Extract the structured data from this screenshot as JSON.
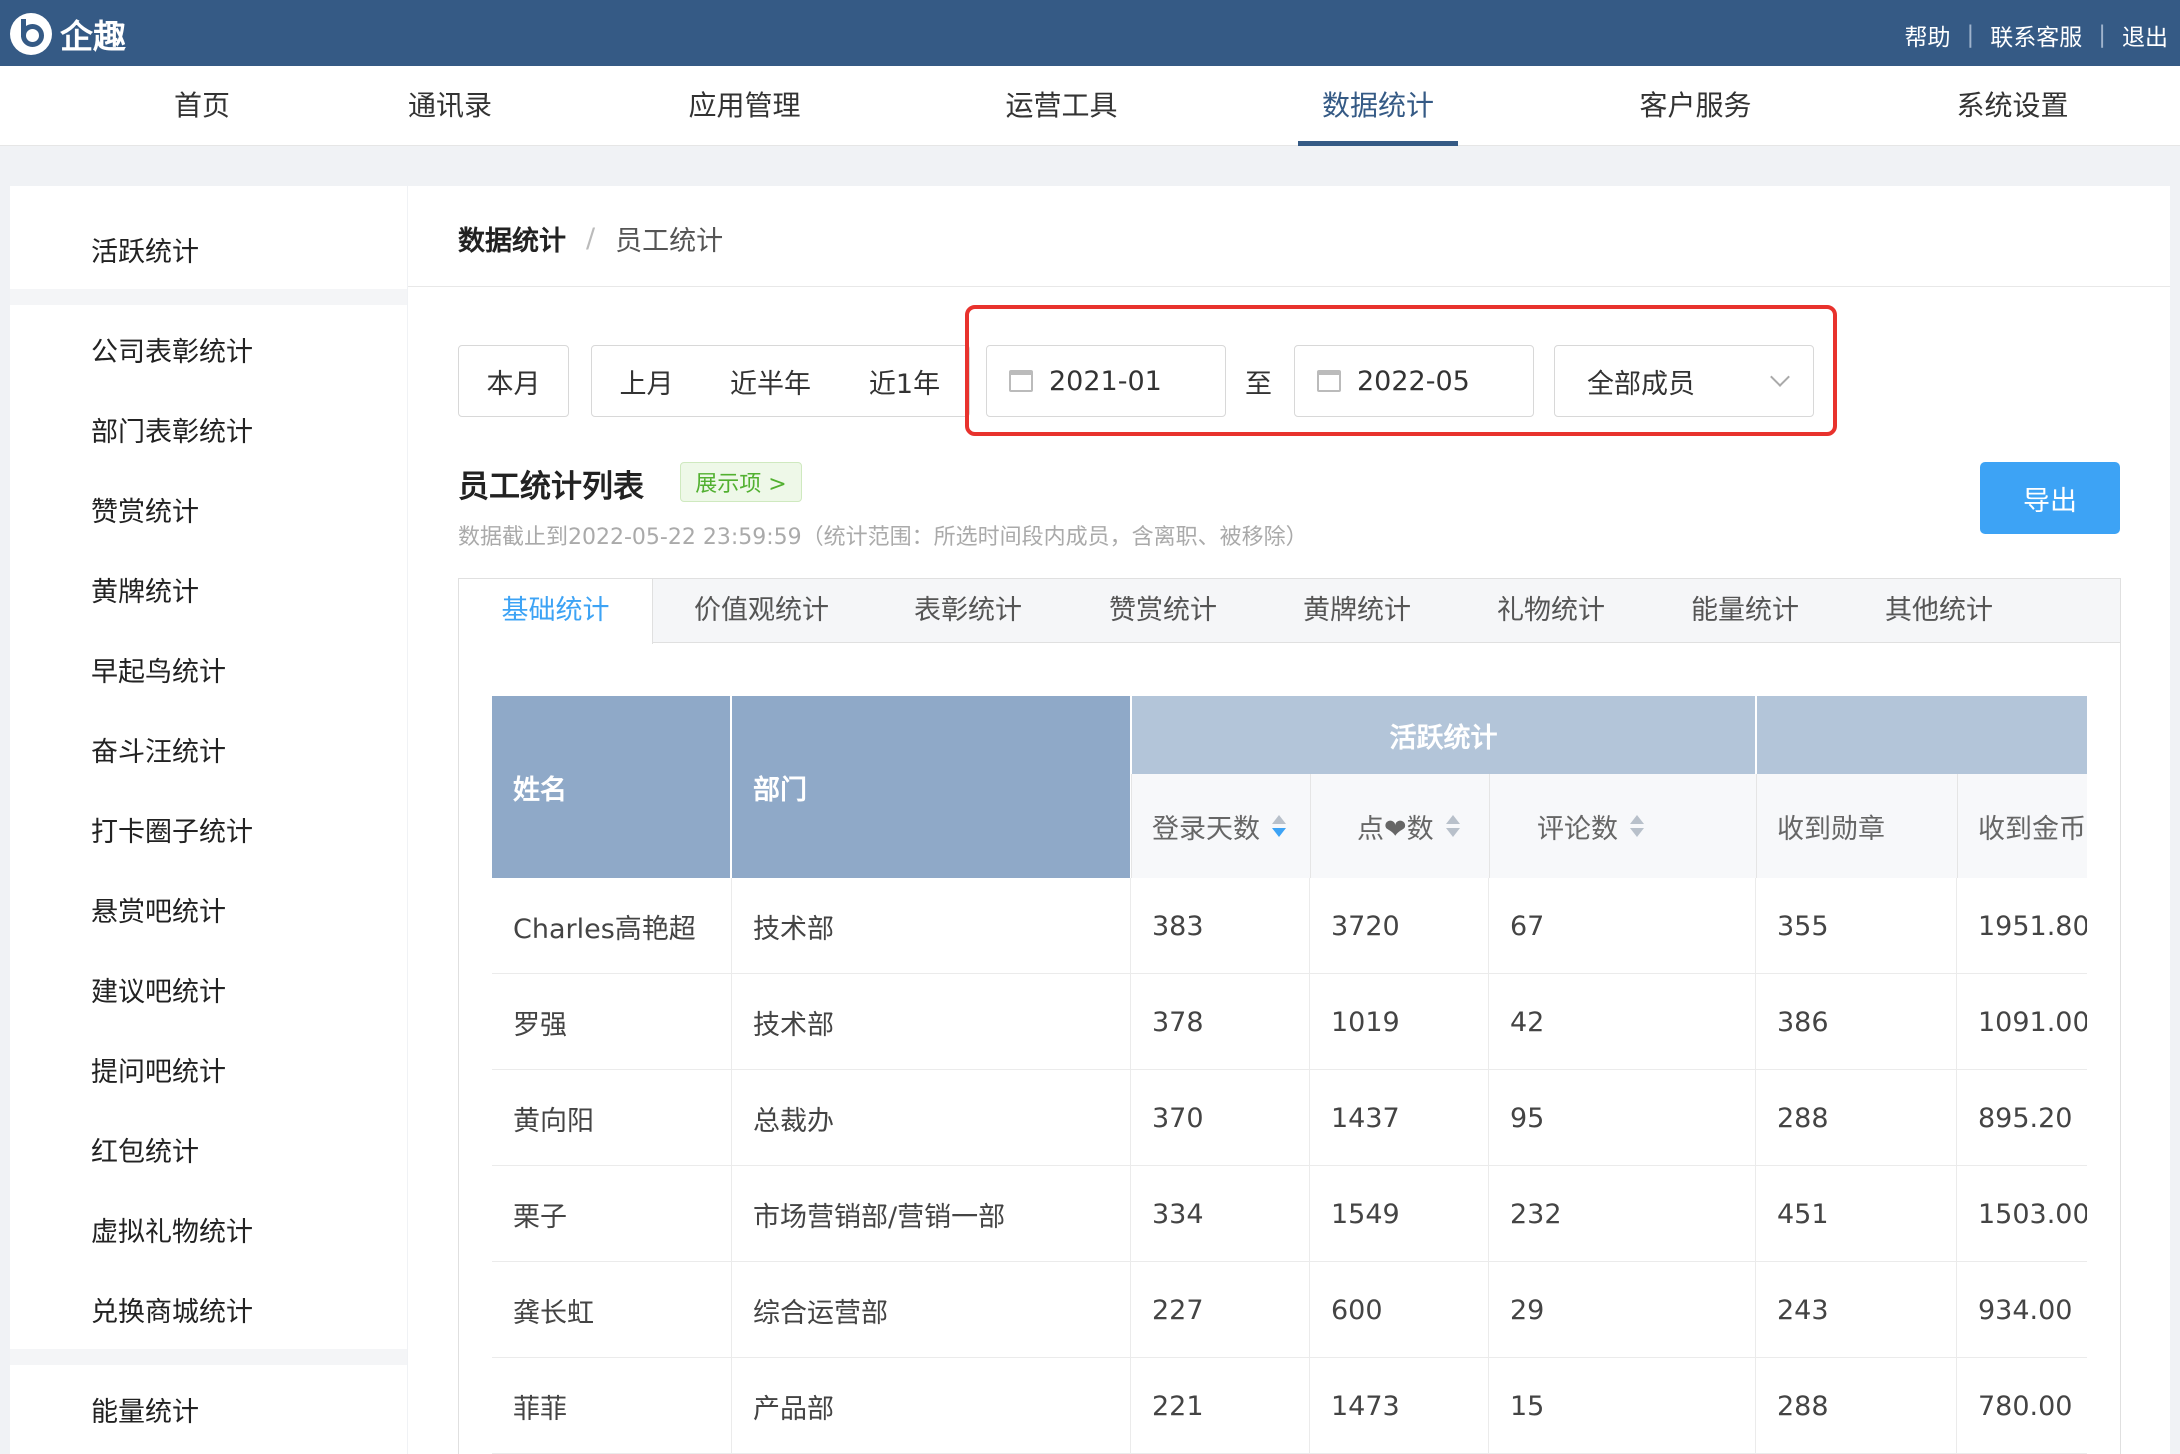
{
  "app": {
    "name": "企趣",
    "links": [
      "帮助",
      "联系客服",
      "退出"
    ]
  },
  "nav": {
    "items": [
      "首页",
      "通讯录",
      "应用管理",
      "运营工具",
      "数据统计",
      "客户服务",
      "系统设置"
    ],
    "active": "数据统计"
  },
  "sidebar": {
    "items": [
      "活跃统计",
      "公司表彰统计",
      "部门表彰统计",
      "赞赏统计",
      "黄牌统计",
      "早起鸟统计",
      "奋斗汪统计",
      "打卡圈子统计",
      "悬赏吧统计",
      "建议吧统计",
      "提问吧统计",
      "红包统计",
      "虚拟礼物统计",
      "兑换商城统计",
      "能量统计"
    ]
  },
  "breadcrumb": {
    "parent": "数据统计",
    "sep": "/",
    "current": "员工统计"
  },
  "filters": {
    "quick": [
      "本月",
      "上月",
      "近半年",
      "近1年"
    ],
    "start_date": "2021-01",
    "to_label": "至",
    "end_date": "2022-05",
    "member_select": "全部成员"
  },
  "list": {
    "title": "员工统计列表",
    "show_items": "展示项 >",
    "note": "数据截止到2022-05-22 23:59:59（统计范围：所选时间段内成员，含离职、被移除）",
    "export": "导出"
  },
  "tabs": [
    "基础统计",
    "价值观统计",
    "表彰统计",
    "赞赏统计",
    "黄牌统计",
    "礼物统计",
    "能量统计",
    "其他统计"
  ],
  "table": {
    "col_name": "姓名",
    "col_dept": "部门",
    "group_active": "活跃统计",
    "sub_cols": [
      "登录天数",
      "点❤数",
      "评论数",
      "收到勋章",
      "收到金币"
    ],
    "rows": [
      [
        "Charles高艳超",
        "技术部",
        "383",
        "3720",
        "67",
        "355",
        "1951.80"
      ],
      [
        "罗强",
        "技术部",
        "378",
        "1019",
        "42",
        "386",
        "1091.00"
      ],
      [
        "黄向阳",
        "总裁办",
        "370",
        "1437",
        "95",
        "288",
        "895.20"
      ],
      [
        "栗子",
        "市场营销部/营销一部",
        "334",
        "1549",
        "232",
        "451",
        "1503.00"
      ],
      [
        "龚长虹",
        "综合运营部",
        "227",
        "600",
        "29",
        "243",
        "934.00"
      ],
      [
        "菲菲",
        "产品部",
        "221",
        "1473",
        "15",
        "288",
        "780.00"
      ]
    ]
  },
  "colors": {
    "brand": "#355a85",
    "accent": "#3da3f5",
    "header_dark": "#8fa9c8",
    "header_light": "#b3c5d9",
    "highlight": "#e8322d"
  }
}
